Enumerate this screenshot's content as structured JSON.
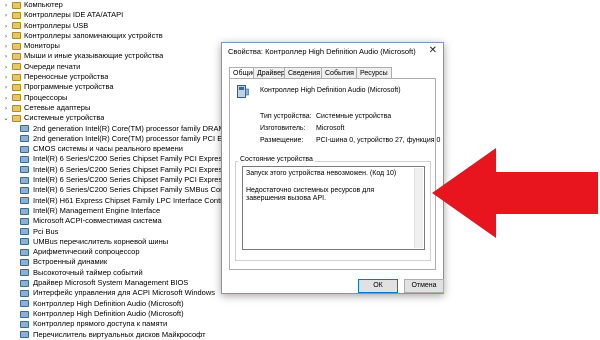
{
  "tree": {
    "rows": [
      {
        "label": "Компьютер",
        "kind": "cat",
        "chev": "›"
      },
      {
        "label": "Контроллеры IDE ATA/ATAPI",
        "kind": "cat",
        "chev": "›"
      },
      {
        "label": "Контроллеры USB",
        "kind": "cat",
        "chev": "›"
      },
      {
        "label": "Контроллеры запоминающих устройств",
        "kind": "cat",
        "chev": "›"
      },
      {
        "label": "Мониторы",
        "kind": "cat",
        "chev": "›"
      },
      {
        "label": "Мыши и иные указывающие устройства",
        "kind": "cat",
        "chev": "›"
      },
      {
        "label": "Очереди печати",
        "kind": "cat",
        "chev": "›"
      },
      {
        "label": "Переносные устройства",
        "kind": "cat",
        "chev": "›"
      },
      {
        "label": "Программные устройства",
        "kind": "cat",
        "chev": "›"
      },
      {
        "label": "Процессоры",
        "kind": "cat",
        "chev": "›"
      },
      {
        "label": "Сетевые адаптеры",
        "kind": "cat",
        "chev": "›"
      },
      {
        "label": "Системные устройства",
        "kind": "cat",
        "chev": "⌄"
      },
      {
        "label": "2nd generation Intel(R) Core(TM) processor family DRAM Controller",
        "kind": "child"
      },
      {
        "label": "2nd generation Intel(R) Core(TM) processor family PCI Express Controller",
        "kind": "child"
      },
      {
        "label": "CMOS системы и часы реального времени",
        "kind": "child"
      },
      {
        "label": "Intel(R) 6 Series/C200 Series Chipset Family PCI Express Root Port",
        "kind": "child"
      },
      {
        "label": "Intel(R) 6 Series/C200 Series Chipset Family PCI Express Root Port",
        "kind": "child"
      },
      {
        "label": "Intel(R) 6 Series/C200 Series Chipset Family PCI Express Root Port",
        "kind": "child"
      },
      {
        "label": "Intel(R) 6 Series/C200 Series Chipset Family SMBus Controller - 1C22",
        "kind": "child"
      },
      {
        "label": "Intel(R) H61 Express Chipset Family LPC Interface Controller - 1C5C",
        "kind": "child"
      },
      {
        "label": "Intel(R) Management Engine Interface",
        "kind": "child"
      },
      {
        "label": "Microsoft ACPI-совместимая система",
        "kind": "child"
      },
      {
        "label": "Pci Bus",
        "kind": "child"
      },
      {
        "label": "UMBus перечислитель корневой шины",
        "kind": "child"
      },
      {
        "label": "Арифметический сопроцессор",
        "kind": "child"
      },
      {
        "label": "Встроенный динамик",
        "kind": "child"
      },
      {
        "label": "Высокоточный таймер событий",
        "kind": "child"
      },
      {
        "label": "Драйвер Microsoft System Management BIOS",
        "kind": "child"
      },
      {
        "label": "Интерфейс управления для ACPI Microsoft Windows",
        "kind": "child"
      },
      {
        "label": "Контроллер High Definition Audio (Microsoft)",
        "kind": "child"
      },
      {
        "label": "Контроллер High Definition Audio (Microsoft)",
        "kind": "child"
      },
      {
        "label": "Контроллер прямого доступа к памяти",
        "kind": "child"
      },
      {
        "label": "Перечислитель виртуальных дисков Майкрософт",
        "kind": "child"
      }
    ]
  },
  "dialog": {
    "title": "Свойства: Контроллер High Definition Audio (Microsoft)",
    "close": "✕",
    "tabs": [
      "Общие",
      "Драйвер",
      "Сведения",
      "События",
      "Ресурсы"
    ],
    "device_name": "Контроллер High Definition Audio (Microsoft)",
    "props": [
      {
        "key": "Тип устройства:",
        "value": "Системные устройства"
      },
      {
        "key": "Изготовитель:",
        "value": "Microsoft"
      },
      {
        "key": "Размещение:",
        "value": "PCI-шина 0, устройство 27, функция 0"
      }
    ],
    "status_group_title": "Состояние устройства",
    "status_line1": "Запуск этого устройства невозможен. (Код 10)",
    "status_line2": "Недостаточно системных ресурсов для завершения вызова API.",
    "ok_label": "ОК",
    "cancel_label": "Отмена"
  },
  "colors": {
    "arrow": "#e8141e",
    "dialog_border": "#7a96b8",
    "ok_border": "#0078d7"
  }
}
